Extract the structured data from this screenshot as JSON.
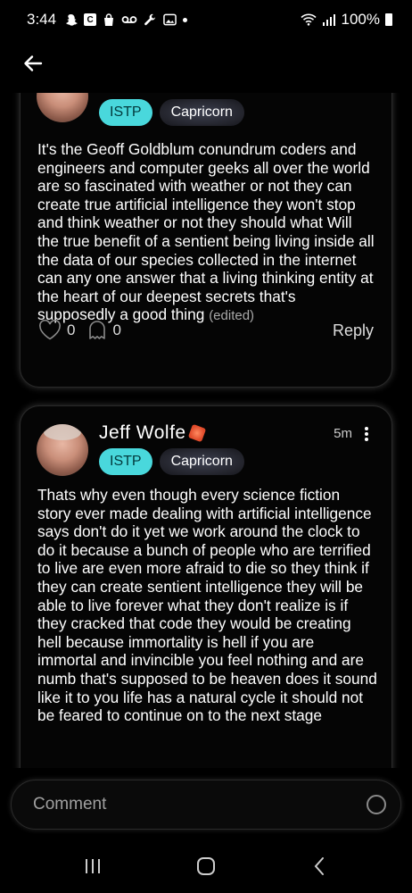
{
  "status_bar": {
    "time": "3:44",
    "battery": "100%",
    "box_letter": "C",
    "icons": [
      "snapchat-icon",
      "c-box-icon",
      "shopping-bag-icon",
      "voicemail-icon",
      "wrench-icon",
      "gallery-icon",
      "dot-icon",
      "wifi-icon",
      "signal-icon",
      "battery-icon"
    ]
  },
  "header": {
    "back_icon": "back-arrow-icon"
  },
  "comments": [
    {
      "mbti": "ISTP",
      "zodiac": "Capricorn",
      "text": "It's the Geoff Goldblum conundrum coders and engineers and computer geeks all over the world are so fascinated with weather or not they can create true artificial intelligence they won't stop and think weather or not they should what Will the true benefit of a sentient being living inside all the data of our species collected in the internet can any one answer that a living thinking entity at the heart of our deepest secrets that's supposedly a good thing",
      "edited": "(edited)",
      "likes": "0",
      "ghosts": "0",
      "reply_label": "Reply"
    },
    {
      "username": "Jeff Wolfe",
      "time": "5m",
      "mbti": "ISTP",
      "zodiac": "Capricorn",
      "text": "Thats why even though every science fiction story ever made dealing with artificial intelligence says don't do it yet we work around the clock to do it because a bunch of people who are terrified to live are even more afraid to die so they think if they can create sentient intelligence they will be able to live forever what they don't realize is if they cracked that code they would be creating hell because immortality is hell if you are immortal and invincible you feel nothing and are numb that's supposed to be heaven does it sound like it to you life has a natural cycle it should not be feared to continue on to the next stage"
    }
  ],
  "comment_bar": {
    "placeholder": "Comment"
  },
  "colors": {
    "mbti_badge": "#49d8dc",
    "background": "#000000",
    "card_border": "#2a2a2a"
  }
}
